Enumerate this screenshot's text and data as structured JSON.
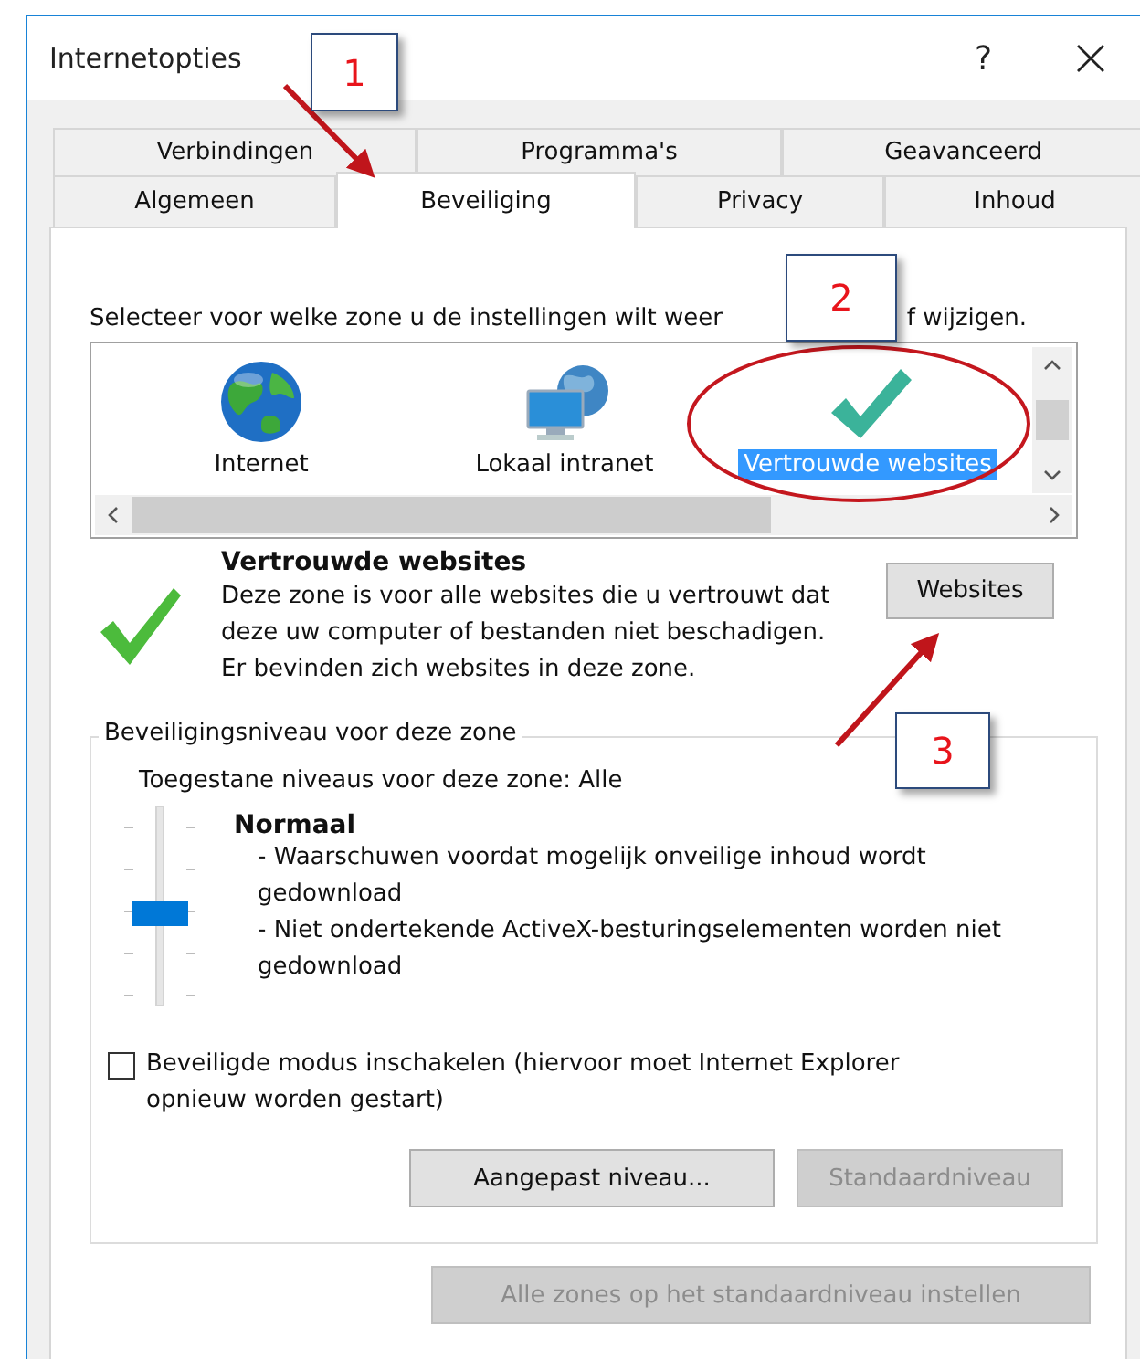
{
  "window": {
    "title": "Internetopties",
    "help": "?"
  },
  "tab_rows": [
    {
      "tabs": [
        {
          "label": "Verbindingen",
          "selected": false
        },
        {
          "label": "Programma's",
          "selected": false
        },
        {
          "label": "Geavanceerd",
          "selected": false
        }
      ]
    },
    {
      "tabs": [
        {
          "label": "Algemeen",
          "selected": false
        },
        {
          "label": "Beveiliging",
          "selected": true
        },
        {
          "label": "Privacy",
          "selected": false
        },
        {
          "label": "Inhoud",
          "selected": false
        }
      ]
    }
  ],
  "zone_prompt": [
    "Selecteer voor welke zone u de instellingen wilt weer",
    "f wijzigen."
  ],
  "zones": [
    {
      "label": "Internet",
      "kind": "globe",
      "selected": false
    },
    {
      "label": "Lokaal intranet",
      "kind": "network",
      "selected": false
    },
    {
      "label": "Vertrouwde websites",
      "kind": "check",
      "selected": true
    }
  ],
  "zone_detail": {
    "title": "Vertrouwde websites",
    "description": [
      "Deze zone is voor alle websites die u vertrouwt dat deze uw computer of bestanden niet beschadigen.",
      "Er bevinden zich websites in deze zone."
    ],
    "button": "Websites"
  },
  "security_level": {
    "legend": "Beveiligingsniveau voor deze zone",
    "allowed": "Toegestane niveaus voor deze zone: Alle",
    "level": 0.5,
    "level_name": "Normaal",
    "points": [
      "- Waarschuwen voordat mogelijk onveilige inhoud wordt gedownload",
      "- Niet ondertekende ActiveX-besturingselementen worden niet gedownload"
    ]
  },
  "protected_mode": {
    "label": "Beveiligde modus inschakelen (hiervoor moet Internet Explorer opnieuw worden gestart)",
    "checked": false
  },
  "level_buttons": [
    {
      "label": "Aangepast niveau...",
      "disabled": false
    },
    {
      "label": "Standaardniveau",
      "disabled": true
    }
  ],
  "reset_all_button": {
    "label": "Alle zones op het standaardniveau instellen",
    "disabled": true
  },
  "annotations": [
    {
      "label": "1"
    },
    {
      "label": "2"
    },
    {
      "label": "3"
    }
  ]
}
